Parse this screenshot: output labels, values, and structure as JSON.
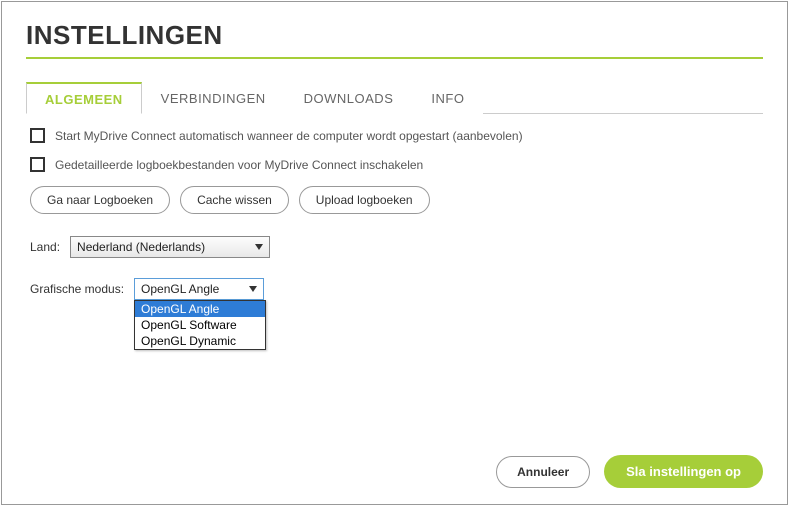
{
  "title": "INSTELLINGEN",
  "tabs": [
    {
      "label": "ALGEMEEN"
    },
    {
      "label": "VERBINDINGEN"
    },
    {
      "label": "DOWNLOADS"
    },
    {
      "label": "INFO"
    }
  ],
  "checkboxes": {
    "autostart": "Start MyDrive Connect automatisch wanneer de computer wordt opgestart (aanbevolen)",
    "detailedLogs": "Gedetailleerde logboekbestanden voor MyDrive Connect inschakelen"
  },
  "buttons": {
    "goToLogs": "Ga naar Logboeken",
    "clearCache": "Cache wissen",
    "uploadLogs": "Upload logboeken"
  },
  "country": {
    "label": "Land:",
    "value": "Nederland (Nederlands)"
  },
  "graphicsMode": {
    "label": "Grafische modus:",
    "value": "OpenGL Angle",
    "options": [
      "OpenGL Angle",
      "OpenGL Software",
      "OpenGL Dynamic"
    ]
  },
  "footer": {
    "cancel": "Annuleer",
    "save": "Sla instellingen op"
  }
}
